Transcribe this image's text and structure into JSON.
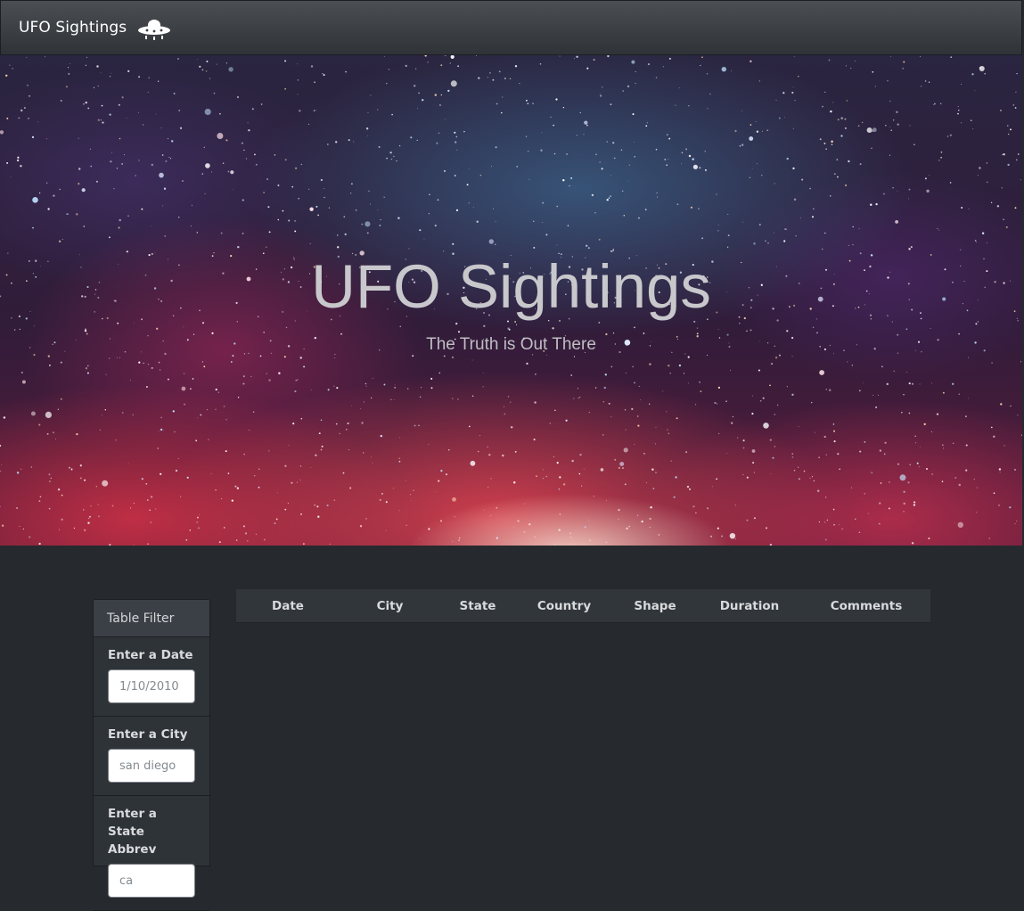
{
  "navbar": {
    "brand": "UFO Sightings",
    "icon": "ufo-icon"
  },
  "hero": {
    "title": "UFO Sightings",
    "subtitle": "The Truth is Out There"
  },
  "filter": {
    "heading": "Table Filter",
    "items": [
      {
        "label": "Enter a Date",
        "placeholder": "1/10/2010"
      },
      {
        "label": "Enter a City",
        "placeholder": "san diego"
      },
      {
        "label": "Enter a State Abbrev",
        "placeholder": "ca"
      }
    ]
  },
  "table": {
    "columns": [
      "Date",
      "City",
      "State",
      "Country",
      "Shape",
      "Duration",
      "Comments"
    ]
  },
  "colors": {
    "navbar_bg": "#3a3e43",
    "page_bg": "#262a2e",
    "text_light": "#d8dadc"
  }
}
